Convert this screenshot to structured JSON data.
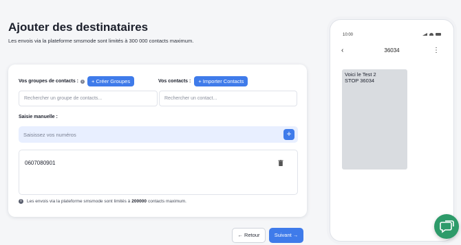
{
  "header": {
    "title": "Ajouter des destinataires",
    "subtitle": "Les envois via la plateforme smsmode sont limités à 300 000 contacts maximum."
  },
  "form": {
    "groups_label": "Vos groupes de contacts :",
    "create_groups_label": "+ Créer Groupes",
    "contacts_label": "Vos contacts :",
    "import_contacts_label": "+ Importer Contacts",
    "group_search_placeholder": "Rechercher un groupe de contacts...",
    "contact_search_placeholder": "Rechercher un contact...",
    "manual_label": "Saisie manuelle :",
    "manual_placeholder": "Saisissez vos numéros",
    "add_label": "+",
    "numbers": [
      "0607080901"
    ],
    "footnote_prefix": "Les envois via la plateforme smsmode sont limités à",
    "footnote_limit": "200000",
    "footnote_suffix": "contacts maximum."
  },
  "actions": {
    "back_label": "← Retour",
    "next_label": "Suivant →"
  },
  "phone": {
    "time": "10:00",
    "back_symbol": "‹",
    "contact": "36034",
    "menu_symbol": "⋮",
    "message_lines": [
      "Voici le Test 2",
      "STOP 36034"
    ]
  },
  "icons": {
    "info": "info-icon",
    "trash": "trash-icon",
    "chat": "chat-icon"
  },
  "colors": {
    "accent": "#3f7bea",
    "chat_fab": "#2e9b6a"
  }
}
